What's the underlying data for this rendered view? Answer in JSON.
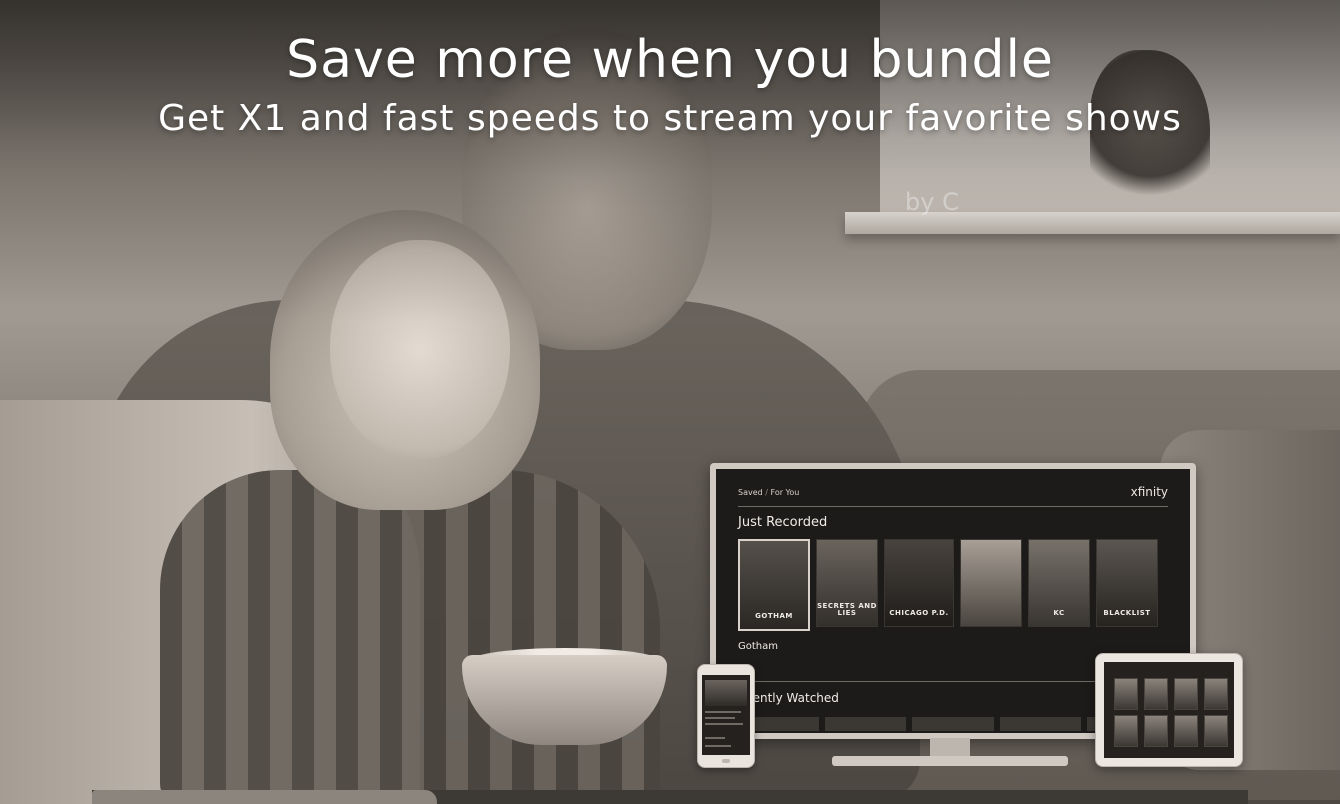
{
  "headline": {
    "title": "Save more when you bundle",
    "subtitle": "Get X1 and fast speeds to stream your favorite shows"
  },
  "watermark": "by C",
  "tv": {
    "nav_saved": "Saved",
    "nav_separator": "/",
    "nav_for_you": "For You",
    "brand": "xfinity",
    "section_just_recorded": "Just Recorded",
    "posters": [
      "GOTHAM",
      "SECRETS AND LIES",
      "CHICAGO P.D.",
      "",
      "KC",
      "BLACKLIST"
    ],
    "selected_title": "Gotham",
    "section_recently_watched": "cently Watched"
  },
  "colors": {
    "headline_text": "#ffffff",
    "tv_screen": "#1d1b19",
    "device_frame": "#cfc9c2"
  }
}
